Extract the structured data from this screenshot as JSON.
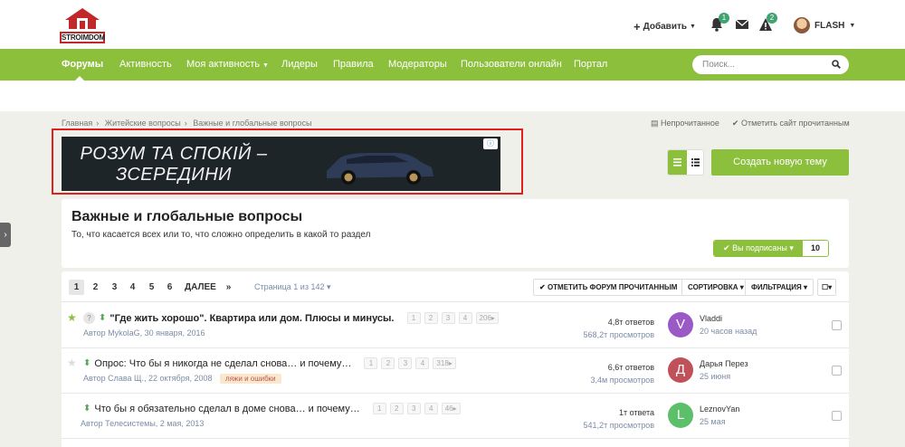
{
  "logo": {
    "text": "STROIMDOM"
  },
  "header": {
    "add_label": "Добавить",
    "notifications_count": "1",
    "alerts_count": "2",
    "username": "FLASH"
  },
  "nav": {
    "items": [
      {
        "label": "Форумы"
      },
      {
        "label": "Активность"
      },
      {
        "label": "Моя активность"
      },
      {
        "label": "Лидеры"
      },
      {
        "label": "Правила"
      },
      {
        "label": "Модераторы"
      },
      {
        "label": "Пользователи онлайн"
      },
      {
        "label": "Портал"
      }
    ],
    "search_placeholder": "Поиск..."
  },
  "breadcrumb": {
    "items": [
      "Главная",
      "Житейские вопросы",
      "Важные и глобальные вопросы"
    ]
  },
  "top_links": {
    "unread": "Непрочитанное",
    "mark_site_read": "Отметить сайт прочитанным"
  },
  "ad": {
    "text_line1": "РОЗУМ ТА СПОКІЙ –",
    "text_line2": "ЗСЕРЕДИНИ"
  },
  "create_topic_label": "Создать новую тему",
  "forum": {
    "title": "Важные и глобальные вопросы",
    "description": "То, что касается всех или то, что сложно определить в какой то раздел",
    "subscribed_label": "Вы подписаны",
    "subscribers_count": "10"
  },
  "pagination": {
    "pages": [
      "1",
      "2",
      "3",
      "4",
      "5",
      "6"
    ],
    "next_label": "ДАЛЕЕ",
    "last_label": "»",
    "page_info": "Страница 1 из 142"
  },
  "toolbar": {
    "mark_read_label": "ОТМЕТИТЬ ФОРУМ ПРОЧИТАННЫМ",
    "sort_label": "СОРТИРОВКА",
    "filter_label": "ФИЛЬТРАЦИЯ"
  },
  "topics": [
    {
      "title": "\"Где жить хорошо\". Квартира или дом. Плюсы и минусы.",
      "meta": "Автор MykolaG, 30 января, 2016",
      "pages": [
        "1",
        "2",
        "3",
        "4",
        "206"
      ],
      "replies": "4,8т ответов",
      "views": "568,2т просмотров",
      "last_user": "Vladdi",
      "last_time": "20 часов назад",
      "avatar_letter": "V",
      "avatar_color": "#9b59c7"
    },
    {
      "title": "Опрос: Что бы я никогда не сделал снова… и почему…",
      "meta": "Автор Слава Щ., 22 октября, 2008",
      "tag": "ляжи и ошибки",
      "pages": [
        "1",
        "2",
        "3",
        "4",
        "318"
      ],
      "replies": "6,6т ответов",
      "views": "3,4м просмотров",
      "last_user": "Дарья Перез",
      "last_time": "25 июня",
      "avatar_letter": "Д",
      "avatar_color": "#c0505a"
    },
    {
      "title": "Что бы я обязательно сделал в доме снова… и почему…",
      "meta": "Автор Телесистемы, 2 мая, 2013",
      "pages": [
        "1",
        "2",
        "3",
        "4",
        "46"
      ],
      "replies": "1т ответа",
      "views": "541,2т просмотров",
      "last_user": "LeznovYan",
      "last_time": "25 мая",
      "avatar_letter": "L",
      "avatar_color": "#5cbf6a"
    }
  ],
  "colors": {
    "accent": "#8cc03c",
    "link": "#7b8ca6",
    "ad_border": "#e02020"
  }
}
